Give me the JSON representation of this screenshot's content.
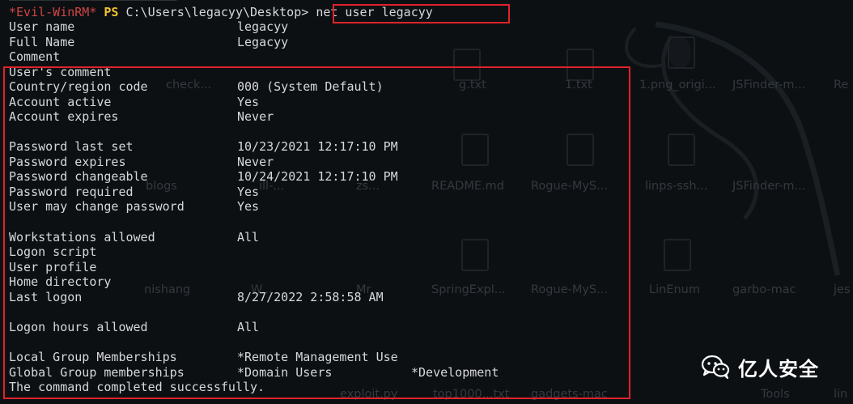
{
  "desktop_ghost_labels": [
    "check...",
    "g.txt",
    "1.txt",
    "1.png_origi...",
    "JSFinder-m...",
    "Re",
    "blogs",
    "ill-...",
    "zs...",
    "README.md",
    "Rogue-MyS...",
    "linps-ssh...",
    "JSFinder-m...",
    "nishang",
    "W...",
    "Mr...",
    "SpringExpl...",
    "Rogue-MyS...",
    "LinEnum",
    "garbo-mac",
    "jes",
    "exploit.py",
    "top1000...txt",
    "gadgets-mac",
    "Tools",
    "lin"
  ],
  "prompt": {
    "evil": "*Evil-WinRM*",
    "ps": "PS",
    "path": "C:\\Users\\legacyy\\Desktop>",
    "command": "net user legacyy"
  },
  "rows": [
    {
      "label": "User name",
      "value": "legacyy"
    },
    {
      "label": "Full Name",
      "value": "Legacyy"
    },
    {
      "label": "Comment",
      "value": ""
    },
    {
      "label": "User's comment",
      "value": ""
    },
    {
      "label": "Country/region code",
      "value": "000 (System Default)"
    },
    {
      "label": "Account active",
      "value": "Yes"
    },
    {
      "label": "Account expires",
      "value": "Never"
    },
    {
      "label": "",
      "value": ""
    },
    {
      "label": "Password last set",
      "value": "10/23/2021 12:17:10 PM"
    },
    {
      "label": "Password expires",
      "value": "Never"
    },
    {
      "label": "Password changeable",
      "value": "10/24/2021 12:17:10 PM"
    },
    {
      "label": "Password required",
      "value": "Yes"
    },
    {
      "label": "User may change password",
      "value": "Yes"
    },
    {
      "label": "",
      "value": ""
    },
    {
      "label": "Workstations allowed",
      "value": "All"
    },
    {
      "label": "Logon script",
      "value": ""
    },
    {
      "label": "User profile",
      "value": ""
    },
    {
      "label": "Home directory",
      "value": ""
    },
    {
      "label": "Last logon",
      "value": "8/27/2022 2:58:58 AM"
    },
    {
      "label": "",
      "value": ""
    },
    {
      "label": "Logon hours allowed",
      "value": "All"
    },
    {
      "label": "",
      "value": ""
    },
    {
      "label": "Local Group Memberships",
      "value": "*Remote Management Use",
      "value2": ""
    },
    {
      "label": "Global Group memberships",
      "value": "*Domain Users",
      "value2": "*Development"
    },
    {
      "label": "The command completed successfully.",
      "value": ""
    }
  ],
  "watermark": {
    "text": "亿人安全",
    "icon": "wechat-icon"
  },
  "colors": {
    "background": "#0d1013",
    "text": "#d6d8da",
    "prompt_evil": "#d04545",
    "prompt_ps": "#f2c230",
    "highlight_box": "#e0222a"
  }
}
